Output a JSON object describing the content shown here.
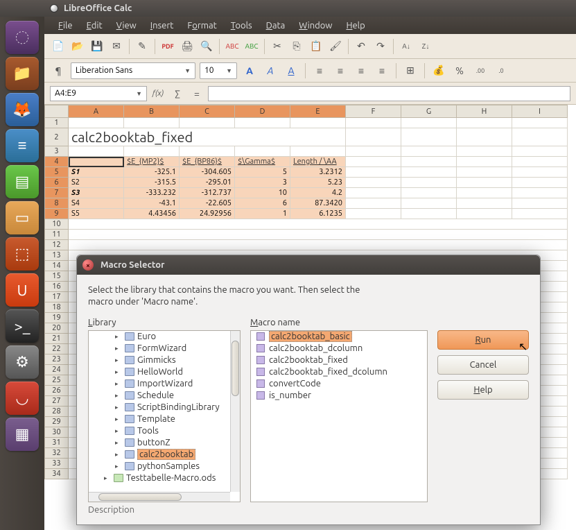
{
  "app_title": "LibreOffice Calc",
  "menus": [
    "File",
    "Edit",
    "View",
    "Insert",
    "Format",
    "Tools",
    "Data",
    "Window",
    "Help"
  ],
  "font_name": "Liberation Sans",
  "font_size": "10",
  "cell_ref": "A4:E9",
  "sheet": {
    "title": "calc2booktab_fixed",
    "cols": [
      "A",
      "B",
      "C",
      "D",
      "E",
      "F",
      "G",
      "H",
      "I"
    ],
    "header_row": [
      "",
      "$E_{MP2}$",
      "$E_{BP86}$",
      "$\\Gamma$",
      "Length / \\AA"
    ],
    "data_rows": [
      {
        "label": "S1",
        "b": "-325.1",
        "c": "-304.605",
        "d": "5",
        "e": "3.2312"
      },
      {
        "label": "S2",
        "b": "-315.5",
        "c": "-295.01",
        "d": "3",
        "e": "5.23"
      },
      {
        "label": "S3",
        "b": "-333.232",
        "c": "-312.737",
        "d": "10",
        "e": "4.2"
      },
      {
        "label": "S4",
        "b": "-43.1",
        "c": "-22.605",
        "d": "6",
        "e": "87.3420"
      },
      {
        "label": "S5",
        "b": "4.43456",
        "c": "24.92956",
        "d": "1",
        "e": "6.1235"
      }
    ]
  },
  "dialog": {
    "title": "Macro Selector",
    "text1": "Select the library that contains the macro you want. Then select the",
    "text2": "macro under 'Macro name'.",
    "library_label": "Library",
    "macro_label": "Macro name",
    "libraries": [
      "Euro",
      "FormWizard",
      "Gimmicks",
      "HelloWorld",
      "ImportWizard",
      "Schedule",
      "ScriptBindingLibrary",
      "Template",
      "Tools",
      "buttonZ",
      "calc2booktab",
      "pythonSamples"
    ],
    "lib_doc": "Testtabelle-Macro.ods",
    "lib_selected": "calc2booktab",
    "macros": [
      "calc2booktab_basic",
      "calc2booktab_dcolumn",
      "calc2booktab_fixed",
      "calc2booktab_fixed_dcolumn",
      "convertCode",
      "is_number"
    ],
    "macro_selected": "calc2booktab_basic",
    "btn_run": "Run",
    "btn_cancel": "Cancel",
    "btn_help": "Help",
    "description_label": "Description"
  }
}
